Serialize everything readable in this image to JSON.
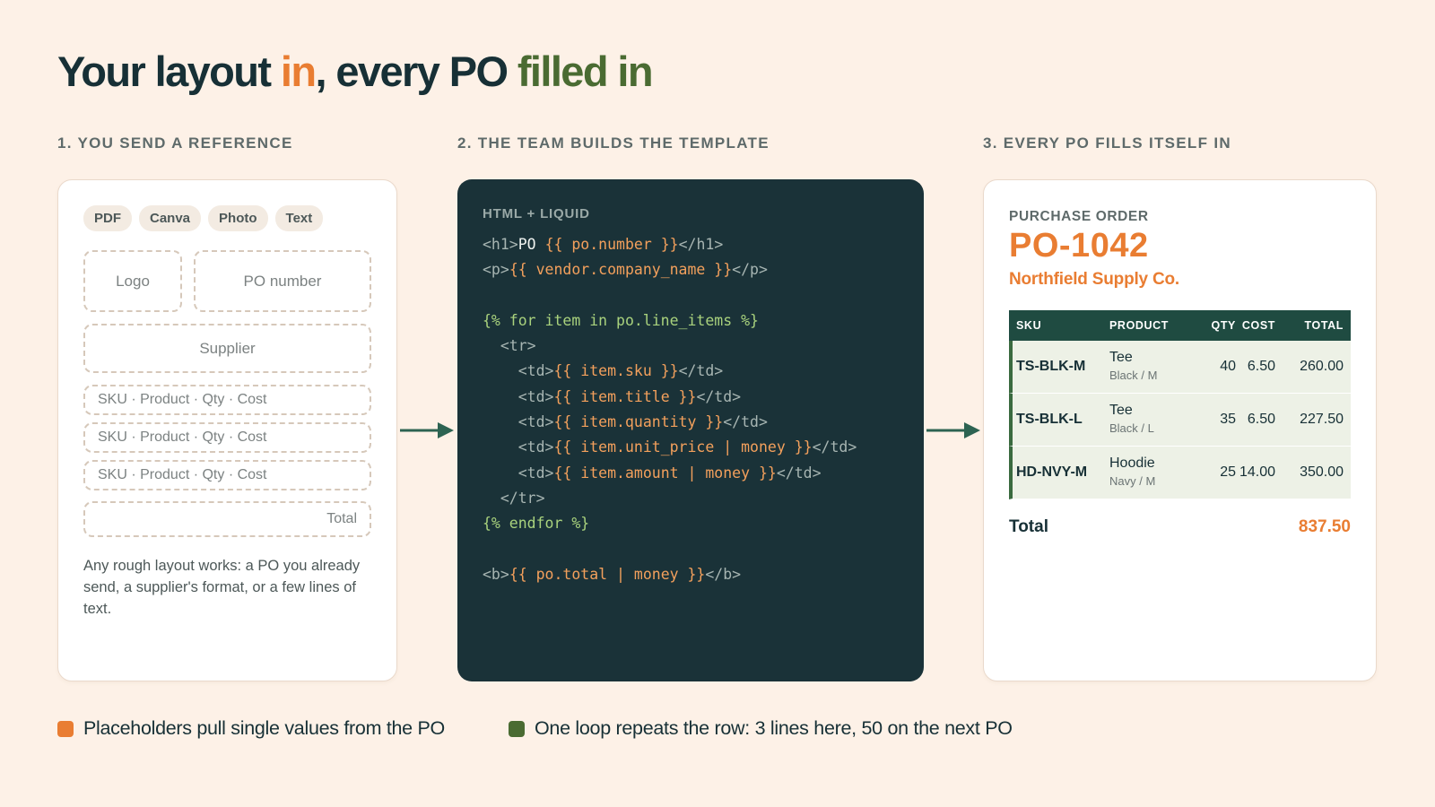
{
  "title": {
    "part1": "Your layout ",
    "part2": "in",
    "part3": ", every PO ",
    "part4": "filled in"
  },
  "steps": [
    {
      "label": "1. YOU SEND A REFERENCE"
    },
    {
      "label": "2. THE TEAM BUILDS THE TEMPLATE"
    },
    {
      "label": "3. EVERY PO FILLS ITSELF IN"
    }
  ],
  "reference": {
    "chips": [
      "PDF",
      "Canva",
      "Photo",
      "Text"
    ],
    "logo": "Logo",
    "po_number": "PO number",
    "supplier": "Supplier",
    "line_rows": [
      "SKU · Product · Qty · Cost",
      "SKU · Product · Qty · Cost",
      "SKU · Product · Qty · Cost"
    ],
    "total": "Total",
    "description": "Any rough layout works: a PO you already send, a supplier's format, or a few lines of text."
  },
  "template": {
    "title": "HTML + LIQUID",
    "lines": [
      [
        [
          "t",
          "<h1>"
        ],
        [
          "w",
          "PO "
        ],
        [
          "o",
          "{{ po.number }}"
        ],
        [
          "t",
          "</h1>"
        ]
      ],
      [
        [
          "t",
          "<p>"
        ],
        [
          "o",
          "{{ vendor.company_name }}"
        ],
        [
          "t",
          "</p>"
        ]
      ],
      [],
      [
        [
          "g",
          "{% for item in po.line_items %}"
        ]
      ],
      [
        [
          "t",
          "  <tr>"
        ]
      ],
      [
        [
          "t",
          "    <td>"
        ],
        [
          "o",
          "{{ item.sku }}"
        ],
        [
          "t",
          "</td>"
        ]
      ],
      [
        [
          "t",
          "    <td>"
        ],
        [
          "o",
          "{{ item.title }}"
        ],
        [
          "t",
          "</td>"
        ]
      ],
      [
        [
          "t",
          "    <td>"
        ],
        [
          "o",
          "{{ item.quantity }}"
        ],
        [
          "t",
          "</td>"
        ]
      ],
      [
        [
          "t",
          "    <td>"
        ],
        [
          "o",
          "{{ item.unit_price | money }}"
        ],
        [
          "t",
          "</td>"
        ]
      ],
      [
        [
          "t",
          "    <td>"
        ],
        [
          "o",
          "{{ item.amount | money }}"
        ],
        [
          "t",
          "</td>"
        ]
      ],
      [
        [
          "t",
          "  </tr>"
        ]
      ],
      [
        [
          "g",
          "{% endfor %}"
        ]
      ],
      [],
      [
        [
          "t",
          "<b>"
        ],
        [
          "o",
          "{{ po.total | money }}"
        ],
        [
          "t",
          "</b>"
        ]
      ]
    ]
  },
  "purchase_order": {
    "kicker": "PURCHASE ORDER",
    "number": "PO-1042",
    "vendor": "Northfield Supply Co.",
    "headers": {
      "sku": "SKU",
      "product": "PRODUCT",
      "qty": "QTY",
      "cost": "COST",
      "total": "TOTAL"
    },
    "rows": [
      {
        "sku": "TS-BLK-M",
        "product": "Tee",
        "variant": "Black / M",
        "qty": "40",
        "cost": "6.50",
        "total": "260.00"
      },
      {
        "sku": "TS-BLK-L",
        "product": "Tee",
        "variant": "Black / L",
        "qty": "35",
        "cost": "6.50",
        "total": "227.50"
      },
      {
        "sku": "HD-NVY-M",
        "product": "Hoodie",
        "variant": "Navy / M",
        "qty": "25",
        "cost": "14.00",
        "total": "350.00"
      }
    ],
    "total_label": "Total",
    "total_value": "837.50"
  },
  "legend": [
    {
      "text": "Placeholders pull single values from the PO",
      "color": "#e97d32"
    },
    {
      "text": "One loop repeats the row: 3 lines here, 50 on the next PO",
      "color": "#4a6b32"
    }
  ],
  "colors": {
    "background": "#fdf1e7",
    "dark": "#1a3238",
    "orange": "#e97d32",
    "green": "#4a6b32",
    "table_header": "#1f4b41"
  }
}
